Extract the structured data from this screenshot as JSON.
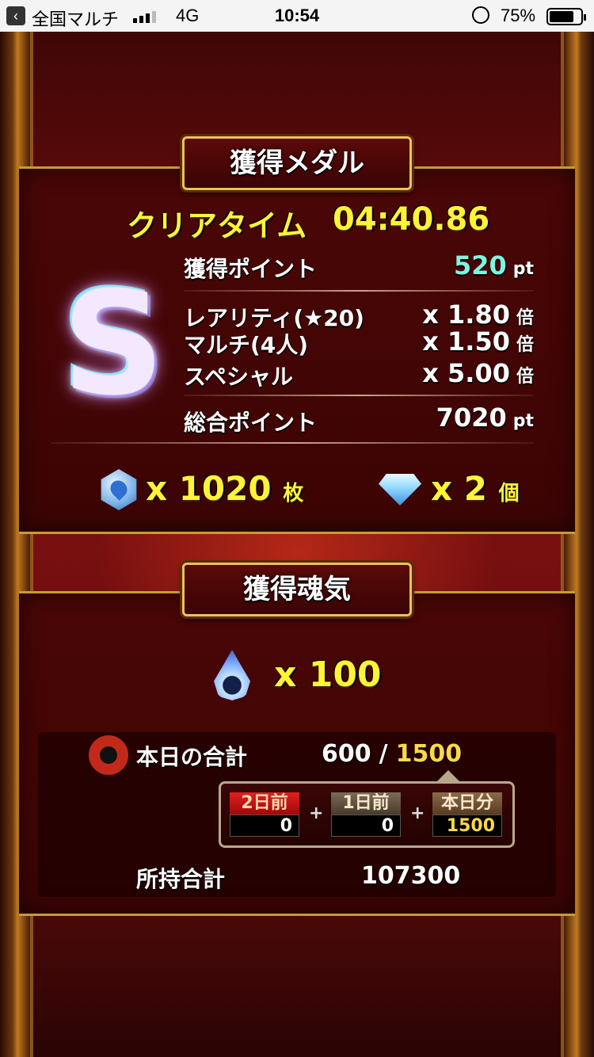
{
  "status_bar": {
    "carrier": "全国マルチ",
    "network": "4G",
    "time": "10:54",
    "battery": "75%"
  },
  "medal_panel": {
    "title": "獲得メダル",
    "clear_time_label": "クリアタイム",
    "clear_time": "04:40.86",
    "rank": "S",
    "earned_points_label": "獲得ポイント",
    "earned_points": "520",
    "pt_unit": "pt",
    "multipliers": [
      {
        "label": "レアリティ(★20)",
        "value": "x 1.80",
        "unit": "倍"
      },
      {
        "label": "マルチ(4人)",
        "value": "x 1.50",
        "unit": "倍"
      },
      {
        "label": "スペシャル",
        "value": "x 5.00",
        "unit": "倍"
      }
    ],
    "total_points_label": "総合ポイント",
    "total_points": "7020",
    "medal_count": "x 1020",
    "medal_unit": "枚",
    "gem_count": "x 2",
    "gem_unit": "個"
  },
  "soul_panel": {
    "title": "獲得魂気",
    "soul_count": "x 100",
    "today_label": "本日の合計",
    "today_current": "600",
    "today_separator": "/",
    "today_max": "1500",
    "breakdown": [
      {
        "label": "2日前",
        "value": "0"
      },
      {
        "label": "1日前",
        "value": "0"
      },
      {
        "label": "本日分",
        "value": "1500"
      }
    ],
    "plus_sign": "+",
    "owned_label": "所持合計",
    "owned_total": "107300"
  },
  "colors": {
    "accent_yellow": "#fff337",
    "points_cyan": "#7ff3e0",
    "gold": "#ffd84a",
    "panel_border": "#c89a3a"
  },
  "icons": [
    "medal-icon",
    "gem-icon",
    "soul-flame-icon",
    "crest-icon",
    "rank-s-badge"
  ]
}
